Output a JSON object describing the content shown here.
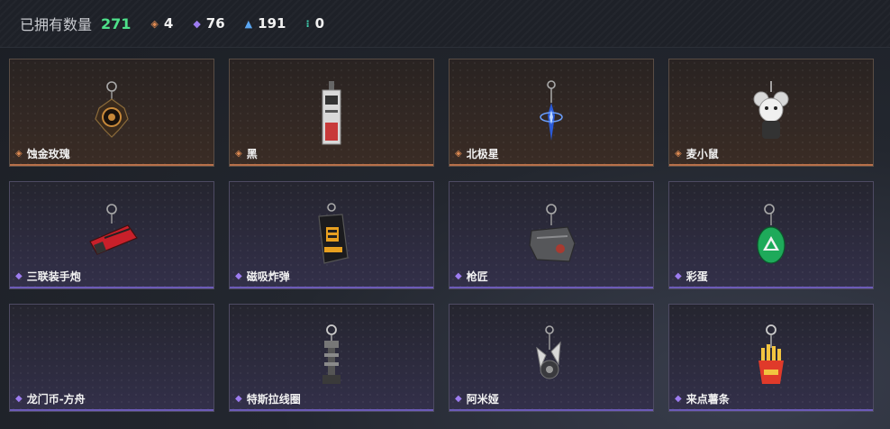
{
  "summary": {
    "owned_label": "已拥有数量",
    "owned_count": "271",
    "counts": [
      {
        "tier": "gold",
        "icon": "diamond-gold-icon",
        "value": "4"
      },
      {
        "tier": "purple",
        "icon": "diamond-purple-icon",
        "value": "76"
      },
      {
        "tier": "blue",
        "icon": "diamond-blue-icon",
        "value": "191"
      },
      {
        "tier": "teal",
        "icon": "dots-teal-icon",
        "value": "0"
      }
    ]
  },
  "colors": {
    "owned_count": "#4ee08a",
    "gold": "#e08b52",
    "purple": "#9d7cf0",
    "blue": "#5aa6f2",
    "teal": "#3fd0b0"
  },
  "items": [
    {
      "name": "蚀金玫瑰",
      "tier": "gold",
      "icon": "rose-charm-icon"
    },
    {
      "name": "黑",
      "tier": "gold",
      "icon": "black-tag-charm-icon"
    },
    {
      "name": "北极星",
      "tier": "gold",
      "icon": "polaris-charm-icon"
    },
    {
      "name": "麦小鼠",
      "tier": "gold",
      "icon": "mouse-charm-icon"
    },
    {
      "name": "三联装手炮",
      "tier": "purple",
      "icon": "hand-cannon-charm-icon"
    },
    {
      "name": "磁吸炸弹",
      "tier": "purple",
      "icon": "magnetic-bomb-charm-icon"
    },
    {
      "name": "枪匠",
      "tier": "purple",
      "icon": "gunsmith-charm-icon"
    },
    {
      "name": "彩蛋",
      "tier": "purple",
      "icon": "easter-egg-charm-icon"
    },
    {
      "name": "龙门币-方舟",
      "tier": "purple",
      "icon": "lungmen-coin-charm-icon"
    },
    {
      "name": "特斯拉线圈",
      "tier": "purple",
      "icon": "tesla-coil-charm-icon"
    },
    {
      "name": "阿米娅",
      "tier": "purple",
      "icon": "amiya-charm-icon"
    },
    {
      "name": "来点薯条",
      "tier": "purple",
      "icon": "fries-charm-icon"
    }
  ]
}
